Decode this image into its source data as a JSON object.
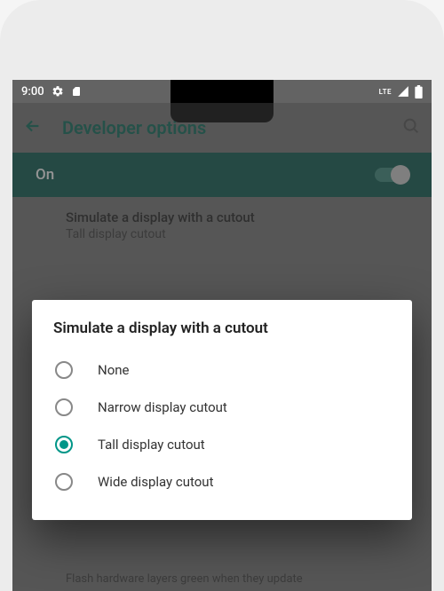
{
  "statusBar": {
    "time": "9:00",
    "lte": "LTE"
  },
  "appBar": {
    "title": "Developer options"
  },
  "mainToggle": {
    "label": "On",
    "state": true
  },
  "currentSetting": {
    "title": "Simulate a display with a cutout",
    "subtitle": "Tall display cutout"
  },
  "backgroundItem": {
    "text": "Flash hardware layers green when they update"
  },
  "dialog": {
    "title": "Simulate a display with a cutout",
    "options": [
      {
        "label": "None",
        "selected": false
      },
      {
        "label": "Narrow display cutout",
        "selected": false
      },
      {
        "label": "Tall display cutout",
        "selected": true
      },
      {
        "label": "Wide display cutout",
        "selected": false
      }
    ]
  },
  "colors": {
    "accent": "#009688",
    "toolbarTeal": "#0a6b5a",
    "toggleBg": "#0a5a4e"
  }
}
